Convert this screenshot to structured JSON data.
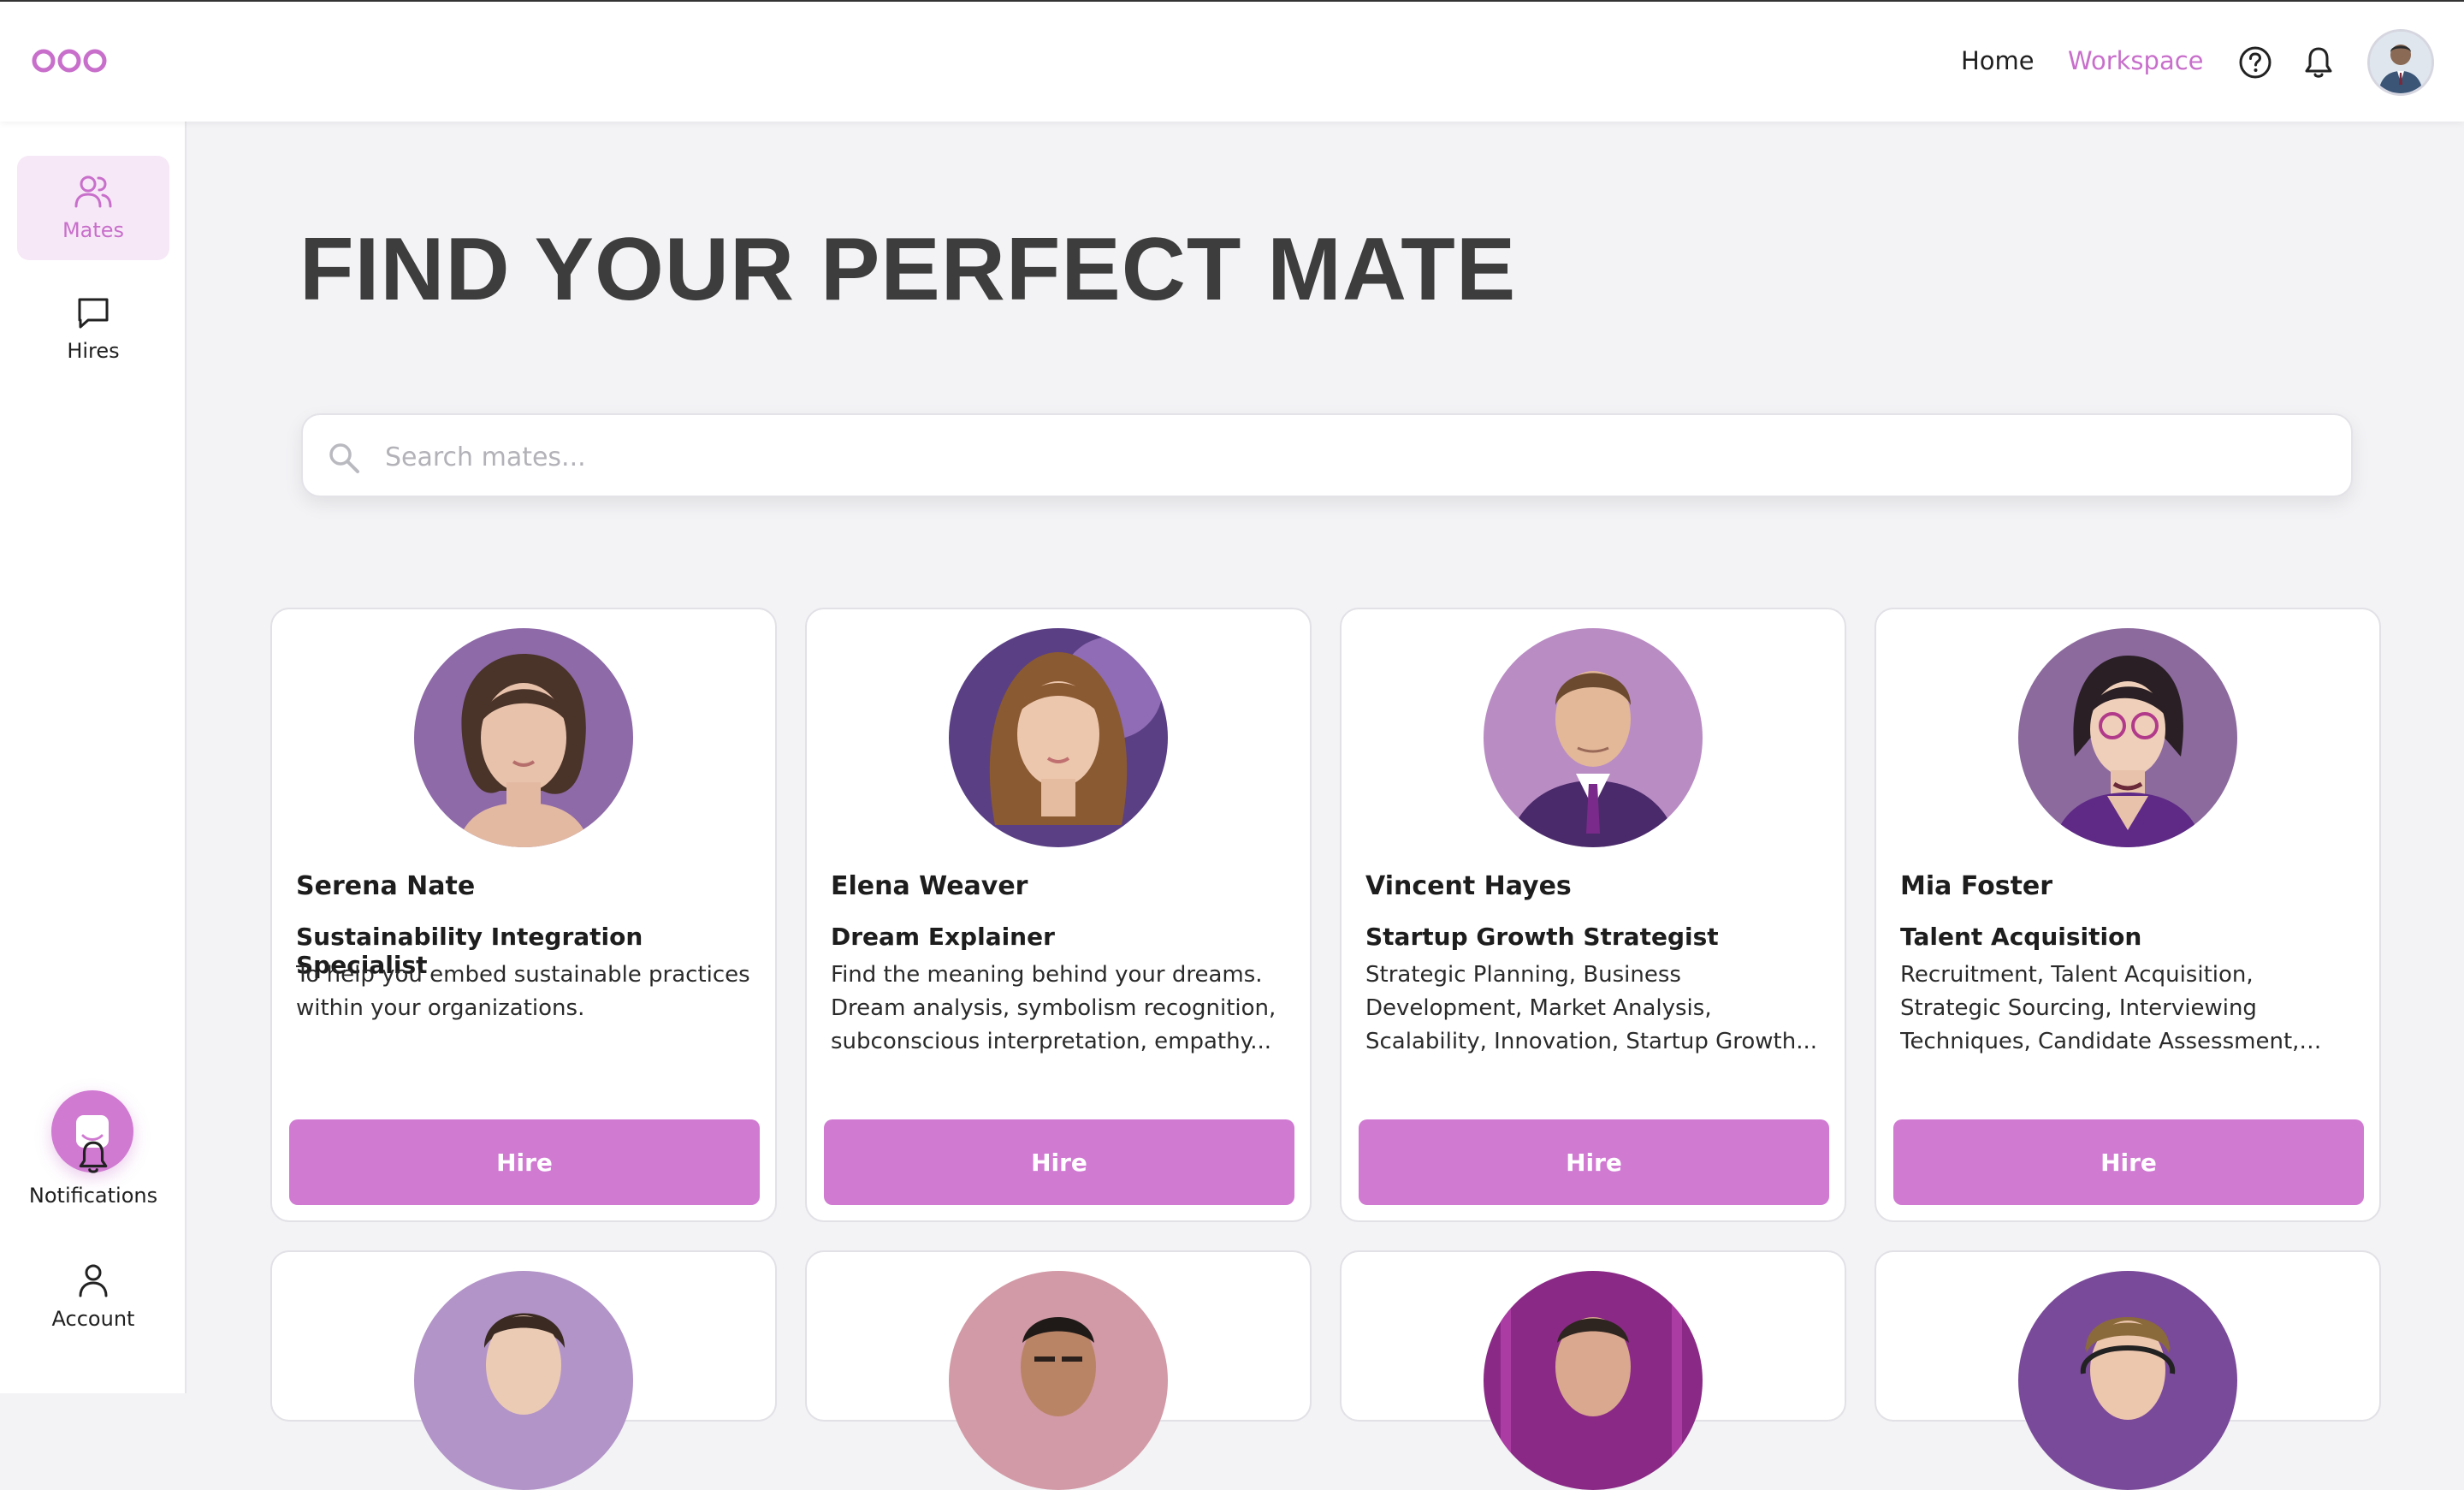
{
  "header": {
    "nav": {
      "home": "Home",
      "workspace": "Workspace"
    },
    "icons": [
      "logo-icon",
      "help-icon",
      "bell-icon",
      "user-avatar"
    ]
  },
  "sidebar": {
    "items": [
      {
        "label": "Mates",
        "icon": "people-icon",
        "active": true
      },
      {
        "label": "Hires",
        "icon": "chat-bubble-icon",
        "active": false
      }
    ],
    "bottom": [
      {
        "label": "Notifications",
        "icon": "bell-icon"
      },
      {
        "label": "Account",
        "icon": "user-icon"
      }
    ]
  },
  "main": {
    "title": "FIND YOUR PERFECT MATE",
    "search": {
      "placeholder": "Search mates...",
      "value": ""
    },
    "hire_label": "Hire",
    "mates": [
      {
        "name": "Serena Nate",
        "role": "Sustainability Integration Specialist",
        "description": "To help you embed sustainable practices within your organizations."
      },
      {
        "name": "Elena Weaver",
        "role": "Dream Explainer",
        "description": "Find the meaning behind your dreams. Dream analysis, symbolism recognition, subconscious interpretation, empathy..."
      },
      {
        "name": "Vincent Hayes",
        "role": "Startup Growth Strategist",
        "description": "Strategic Planning, Business Development, Market Analysis, Scalability, Innovation, Startup Growth..."
      },
      {
        "name": "Mia Foster",
        "role": "Talent Acquisition",
        "description": "Recruitment, Talent Acquisition, Strategic Sourcing, Interviewing Techniques, Candidate Assessment, Startups..."
      }
    ]
  },
  "colors": {
    "accent": "#c86fcb",
    "button": "#d07ad2",
    "active_bg": "#f6e8f6",
    "title": "#3d3d3d"
  }
}
